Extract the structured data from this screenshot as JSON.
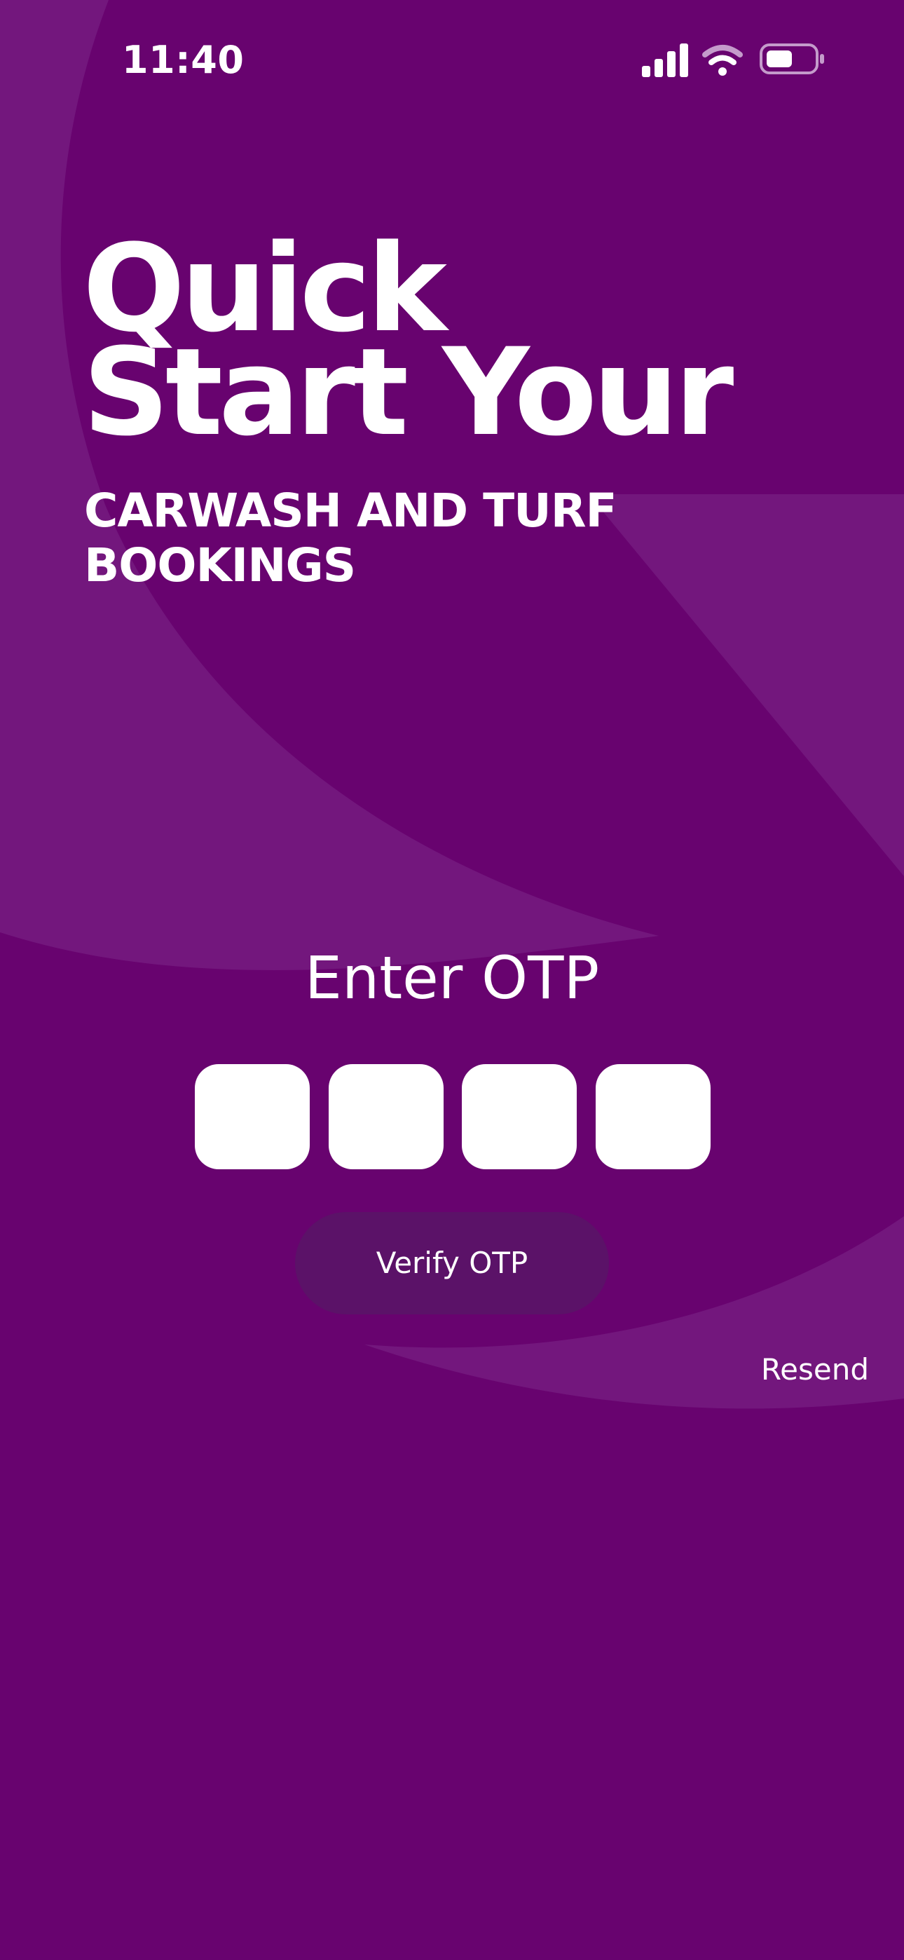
{
  "status_bar": {
    "time": "11:40",
    "icons": [
      "cellular-signal-icon",
      "wifi-icon",
      "battery-icon"
    ]
  },
  "hero": {
    "headline_line1": "Quick",
    "headline_line2": "Start Your",
    "subheadline_line1": "CARWASH AND TURF",
    "subheadline_line2": "BOOKINGS"
  },
  "otp": {
    "title": "Enter OTP",
    "boxes": [
      "",
      "",
      "",
      ""
    ],
    "verify_label": "Verify OTP",
    "resend_label": "Resend"
  },
  "colors": {
    "background": "#68036F",
    "background_shape": "#761B80",
    "verify_button": "#5B1268",
    "otp_box": "#FFFFFF",
    "text": "#FFFFFF"
  }
}
